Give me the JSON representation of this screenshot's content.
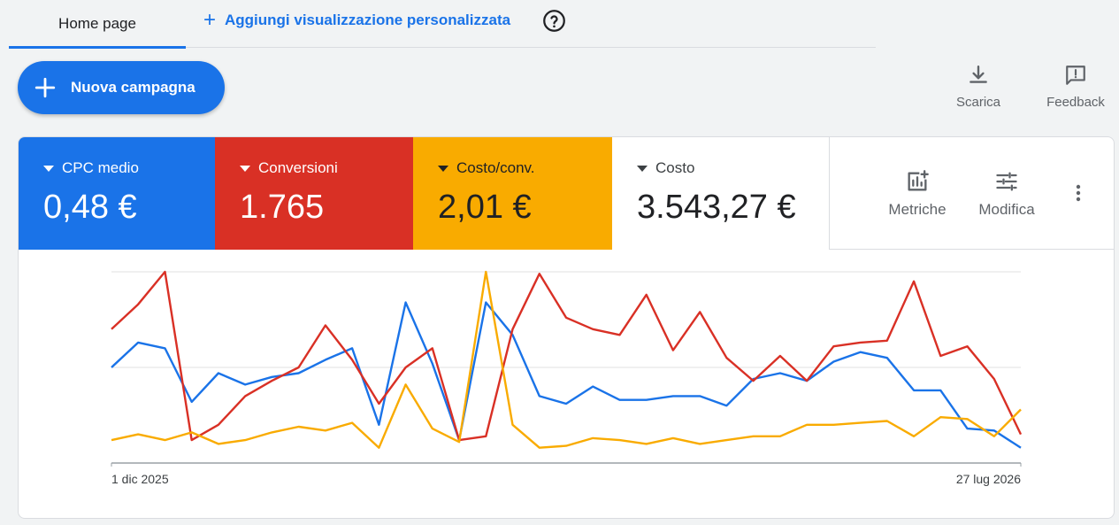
{
  "tabs": {
    "home": "Home page",
    "add_view": "Aggiungi visualizzazione personalizzata"
  },
  "fab": {
    "label": "Nuova campagna"
  },
  "actions": {
    "download": "Scarica",
    "feedback": "Feedback"
  },
  "metrics": [
    {
      "label": "CPC medio",
      "value": "0,48 €",
      "color": "#1a73e8"
    },
    {
      "label": "Conversioni",
      "value": "1.765",
      "color": "#d93025"
    },
    {
      "label": "Costo/conv.",
      "value": "2,01 €",
      "color": "#f9ab00"
    },
    {
      "label": "Costo",
      "value": "3.543,27 €",
      "color": "#ffffff"
    }
  ],
  "tools": {
    "metrics": "Metriche",
    "edit": "Modifica"
  },
  "chart_data": {
    "type": "line",
    "x_start_label": "1 dic 2025",
    "x_end_label": "27 lug 2026",
    "ylim": [
      0,
      100
    ],
    "grid": true,
    "series": [
      {
        "color": "#1a73e8",
        "values": [
          50,
          63,
          60,
          32,
          47,
          41,
          45,
          47,
          54,
          60,
          20,
          84,
          52,
          12,
          84,
          67,
          35,
          31,
          40,
          33,
          33,
          35,
          35,
          30,
          44,
          47,
          43,
          53,
          58,
          55,
          38,
          38,
          18,
          17,
          8
        ]
      },
      {
        "color": "#d93025",
        "values": [
          70,
          83,
          100,
          12,
          20,
          35,
          43,
          50,
          72,
          54,
          31,
          50,
          60,
          12,
          14,
          70,
          99,
          76,
          70,
          67,
          88,
          59,
          79,
          55,
          43,
          56,
          43,
          61,
          63,
          64,
          95,
          56,
          61,
          44,
          15
        ]
      },
      {
        "color": "#f9ab00",
        "values": [
          12,
          15,
          12,
          16,
          10,
          12,
          16,
          19,
          17,
          21,
          8,
          41,
          18,
          11,
          100,
          20,
          8,
          9,
          13,
          12,
          10,
          13,
          10,
          12,
          14,
          14,
          20,
          20,
          21,
          22,
          14,
          24,
          23,
          14,
          28
        ]
      }
    ]
  }
}
